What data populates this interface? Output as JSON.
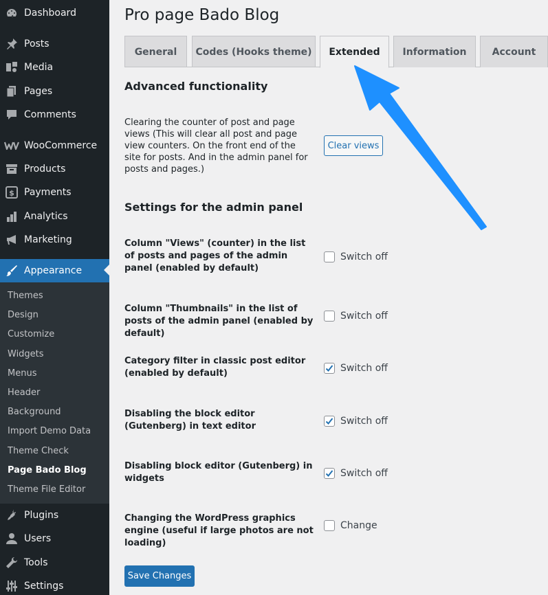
{
  "sidebar": {
    "menu": [
      {
        "label": "Dashboard",
        "icon": "dashboard-icon"
      },
      {
        "label": "Posts",
        "icon": "pin-icon"
      },
      {
        "label": "Media",
        "icon": "media-icon"
      },
      {
        "label": "Pages",
        "icon": "pages-icon"
      },
      {
        "label": "Comments",
        "icon": "comments-icon"
      },
      {
        "label": "WooCommerce",
        "icon": "woocommerce-icon"
      },
      {
        "label": "Products",
        "icon": "archive-icon"
      },
      {
        "label": "Payments",
        "icon": "dollar-icon"
      },
      {
        "label": "Analytics",
        "icon": "bar-chart-icon"
      },
      {
        "label": "Marketing",
        "icon": "megaphone-icon"
      },
      {
        "label": "Appearance",
        "icon": "paintbrush-icon"
      },
      {
        "label": "Plugins",
        "icon": "plug-icon"
      },
      {
        "label": "Users",
        "icon": "user-icon"
      },
      {
        "label": "Tools",
        "icon": "wrench-icon"
      },
      {
        "label": "Settings",
        "icon": "sliders-icon"
      }
    ],
    "submenu": [
      {
        "label": "Themes"
      },
      {
        "label": "Design"
      },
      {
        "label": "Customize"
      },
      {
        "label": "Widgets"
      },
      {
        "label": "Menus"
      },
      {
        "label": "Header"
      },
      {
        "label": "Background"
      },
      {
        "label": "Import Demo Data"
      },
      {
        "label": "Theme Check"
      },
      {
        "label": "Page Bado Blog"
      },
      {
        "label": "Theme File Editor"
      }
    ]
  },
  "page": {
    "title": "Pro page Bado Blog"
  },
  "tabs": [
    {
      "label": "General"
    },
    {
      "label": "Codes (Hooks theme)"
    },
    {
      "label": "Extended"
    },
    {
      "label": "Information"
    },
    {
      "label": "Account"
    }
  ],
  "sections": {
    "advanced": {
      "title": "Advanced functionality",
      "clear_desc": "Clearing the counter of post and page views (This will clear all post and page view counters. On the front end of the site for posts. And in the admin panel for posts and pages.)",
      "clear_button": "Clear views"
    },
    "admin": {
      "title": "Settings for the admin panel",
      "options": [
        {
          "label": "Column \"Views\" (counter) in the list of posts and pages of the admin panel (enabled by default)",
          "checkbox_label": "Switch off",
          "checked": false
        },
        {
          "label": "Column \"Thumbnails\" in the list of posts of the admin panel (enabled by default)",
          "checkbox_label": "Switch off",
          "checked": false
        },
        {
          "label": "Category filter in classic post editor (enabled by default)",
          "checkbox_label": "Switch off",
          "checked": true
        },
        {
          "label": "Disabling the block editor (Gutenberg) in text editor",
          "checkbox_label": "Switch off",
          "checked": true
        },
        {
          "label": "Disabling block editor (Gutenberg) in widgets",
          "checkbox_label": "Switch off",
          "checked": true
        },
        {
          "label": "Changing the WordPress graphics engine (useful if large photos are not loading)",
          "checkbox_label": "Change",
          "checked": false
        }
      ]
    }
  },
  "save_button": "Save Changes",
  "colors": {
    "accent": "#2271b1",
    "sidebar": "#1d2327",
    "arrow": "#1e90ff"
  }
}
